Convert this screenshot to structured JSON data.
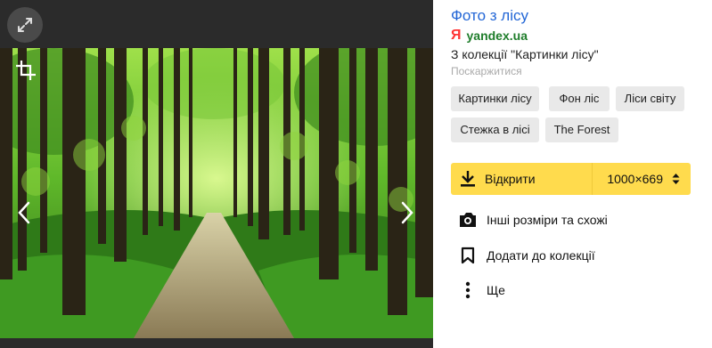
{
  "viewer": {
    "expand_icon": "expand-arrows-icon",
    "crop_icon": "crop-icon",
    "prev_icon": "chevron-left-icon",
    "next_icon": "chevron-right-icon"
  },
  "panel": {
    "title": "Фото з лісу",
    "source_logo": "Я",
    "source_domain": "yandex.ua",
    "collection": "З колекції \"Картинки лісу\"",
    "report": "Поскаржитися",
    "tags": [
      "Картинки лісу",
      "Фон ліс",
      "Ліси світу",
      "Стежка в лісі",
      "The Forest"
    ],
    "open_label": "Відкрити",
    "size_label": "1000×669",
    "actions": [
      {
        "label": "Інші розміри та схожі",
        "icon": "camera-search-icon"
      },
      {
        "label": "Додати до колекції",
        "icon": "bookmark-icon"
      },
      {
        "label": "Ще",
        "icon": "more-vertical-icon"
      }
    ]
  },
  "colors": {
    "title_link": "#2266d6",
    "source_domain": "#1f7d2b",
    "yandex_red": "#ff3333",
    "open_button": "#ffdb4d",
    "tag_bg": "#e9e9e9"
  }
}
